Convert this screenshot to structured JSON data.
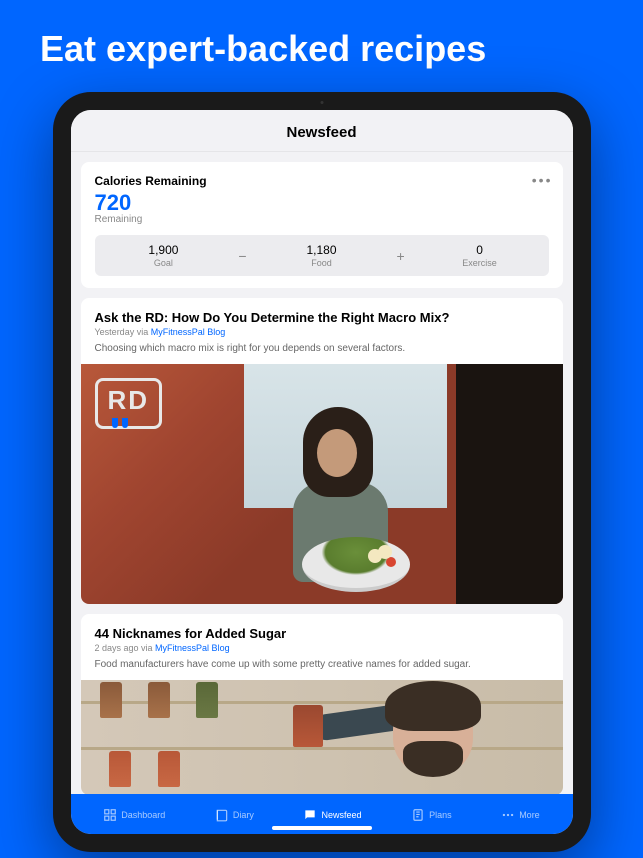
{
  "hero": {
    "title": "Eat expert-backed recipes"
  },
  "header": {
    "title": "Newsfeed"
  },
  "calories": {
    "label": "Calories Remaining",
    "value": "720",
    "sublabel": "Remaining",
    "breakdown": {
      "goal": {
        "value": "1,900",
        "label": "Goal"
      },
      "food": {
        "value": "1,180",
        "label": "Food"
      },
      "exercise": {
        "value": "0",
        "label": "Exercise"
      },
      "minus": "−",
      "plus": "+"
    }
  },
  "articles": [
    {
      "title": "Ask the RD: How Do You Determine the Right Macro Mix?",
      "time": "Yesterday via ",
      "source": "MyFitnessPal Blog",
      "excerpt": "Choosing which macro mix is right for you depends on several factors.",
      "badge": "RD"
    },
    {
      "title": "44 Nicknames for Added Sugar",
      "time": "2 days ago via ",
      "source": "MyFitnessPal Blog",
      "excerpt": "Food manufacturers have come up with some pretty creative names for added sugar."
    }
  ],
  "tabs": {
    "dashboard": "Dashboard",
    "diary": "Diary",
    "newsfeed": "Newsfeed",
    "plans": "Plans",
    "more": "More"
  }
}
